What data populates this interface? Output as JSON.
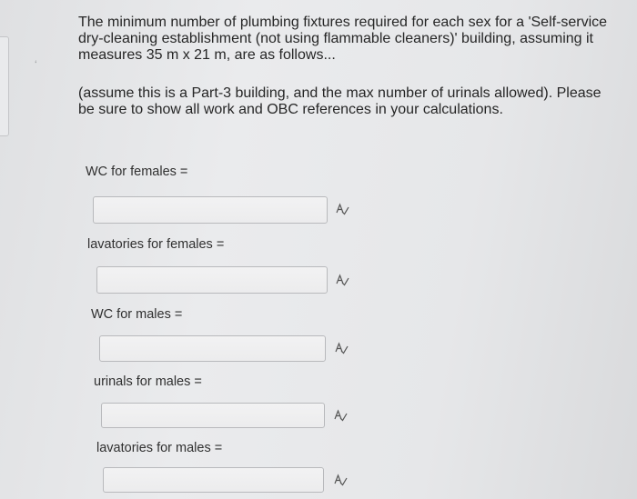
{
  "question": {
    "paragraph1": "The minimum number of plumbing fixtures required for each sex for a 'Self-service dry-cleaning establishment (not using flammable cleaners)' building, assuming it measures 35 m x 21 m, are as follows...",
    "paragraph2": "(assume this is a Part-3 building, and the max number of urinals allowed). Please be sure to show all work and OBC references in your calculations."
  },
  "fields": [
    {
      "label": "WC for females =",
      "value": "",
      "icon": "spellcheck-icon"
    },
    {
      "label": "lavatories for females =",
      "value": "",
      "icon": "spellcheck-icon"
    },
    {
      "label": "WC for males =",
      "value": "",
      "icon": "spellcheck-icon"
    },
    {
      "label": "urinals for males =",
      "value": "",
      "icon": "spellcheck-icon"
    },
    {
      "label": "lavatories for males =",
      "value": "",
      "icon": "spellcheck-icon"
    }
  ],
  "colors": {
    "background": "#e6e7e9",
    "text": "#262626",
    "box_border": "#b8b9bc"
  }
}
